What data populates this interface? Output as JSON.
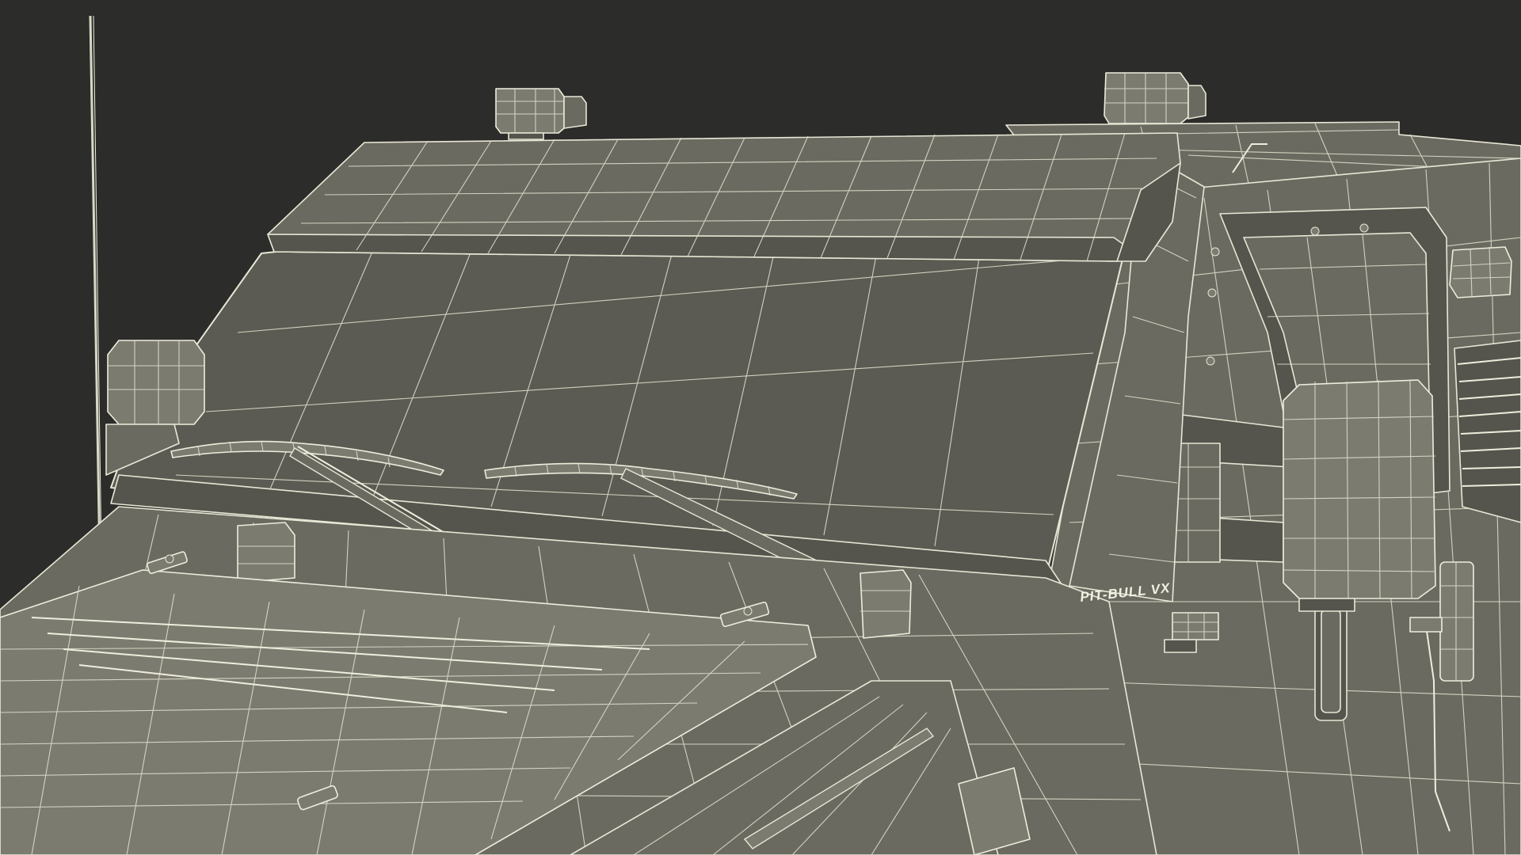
{
  "viewport": {
    "background": "#2c2c2a",
    "model_fill": "#6b6a60",
    "wire_color": "#e8e7d6"
  },
  "model": {
    "label": "PIT-BULL VX"
  }
}
